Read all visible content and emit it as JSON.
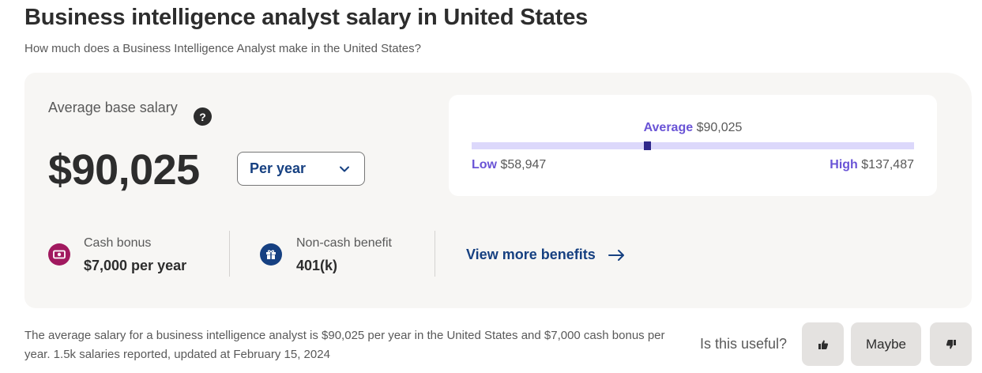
{
  "header": {
    "title": "Business intelligence analyst salary in United States",
    "subtitle": "How much does a Business Intelligence Analyst make in the United States?"
  },
  "salary": {
    "label": "Average base salary",
    "help_glyph": "?",
    "amount": "$90,025",
    "period_selected": "Per year",
    "period_options": [
      "Per year"
    ]
  },
  "range": {
    "average_label": "Average",
    "average_value": "$90,025",
    "low_label": "Low",
    "low_value": "$58,947",
    "high_label": "High",
    "high_value": "$137,487",
    "low_num": 58947,
    "high_num": 137487,
    "average_num": 90025
  },
  "benefits": [
    {
      "icon": "cash-icon",
      "label": "Cash bonus",
      "value": "$7,000 per year",
      "color": "#a1195f"
    },
    {
      "icon": "gift-icon",
      "label": "Non-cash benefit",
      "value": "401(k)",
      "color": "#164081"
    }
  ],
  "view_more": {
    "label": "View more benefits"
  },
  "footer": {
    "text": "The average salary for a business intelligence analyst is $90,025 per year in the United States and $7,000 cash bonus per year. 1.5k salaries reported, updated at February 15, 2024",
    "useful_question": "Is this useful?",
    "maybe_label": "Maybe"
  },
  "colors": {
    "accent_purple": "#6a54d6",
    "marker": "#2f288a",
    "link_blue": "#164081",
    "card_bg": "#f7f6f4"
  }
}
